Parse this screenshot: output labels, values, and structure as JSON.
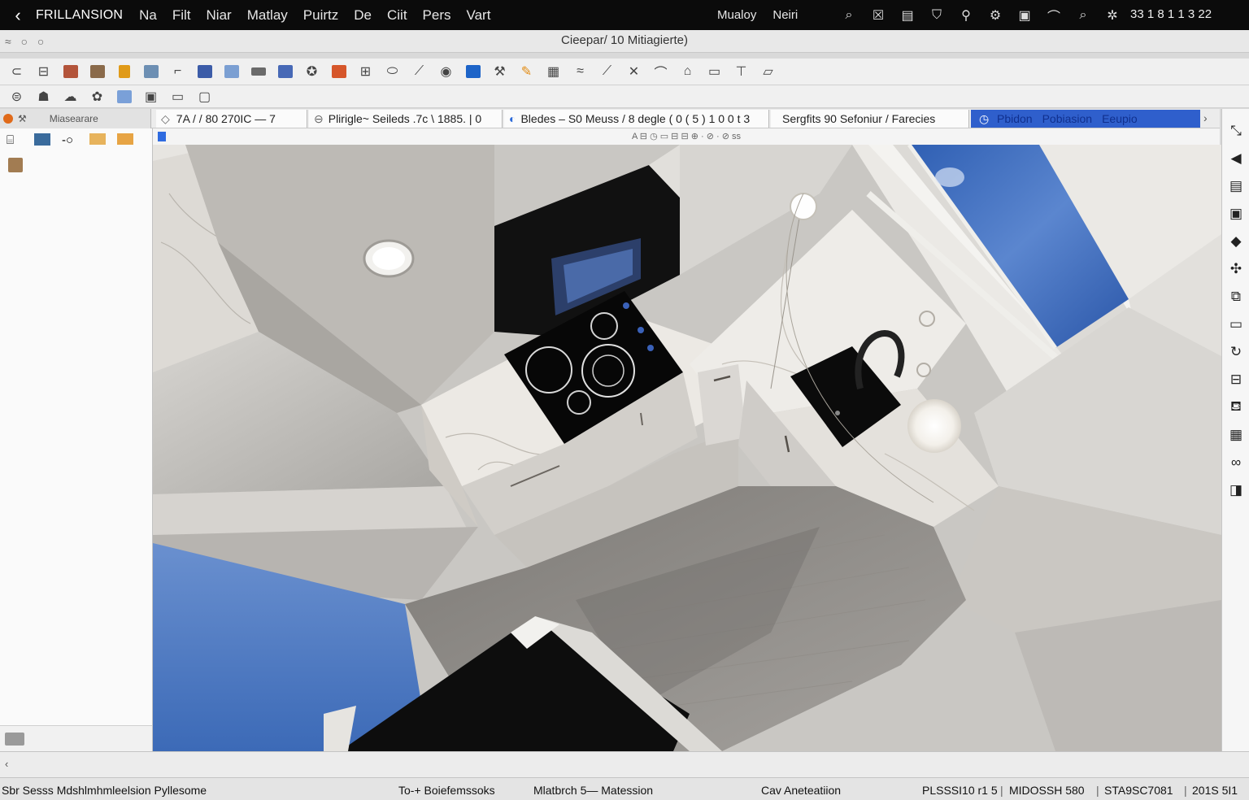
{
  "menubar": {
    "app_name": "FRILLANSION",
    "items": [
      "Na",
      "Filt",
      "Niar",
      "Matlay",
      "Puirtz",
      "De",
      "Ciit",
      "Pers",
      "Vart"
    ],
    "right_items": [
      "Mualoy",
      "Neiri"
    ],
    "clock": "33 1 8 1 1 3 22"
  },
  "titlebar": {
    "title": "Cieepar/ 10 Mitiagierte)"
  },
  "left_panel": {
    "header": "Miasearare"
  },
  "tabs": [
    {
      "label": "7A / / 80 270IC — 7"
    },
    {
      "label": "Plirigle~ Seileds .7c \\ 1885. | 0"
    },
    {
      "label": "Bledes – S0 Meuss / 8 degle ( 0 ( 5 ) 1 0 0 t 3"
    },
    {
      "label": "Sergfits 90 Sefoniur / Farecies"
    },
    {
      "label": "Pbidon"
    },
    {
      "label": "Pobiasion"
    },
    {
      "label": "Eeupio"
    }
  ],
  "subruler": {
    "label": "A ⊟ ◷ ▭ ⊟ ⊟ ⊕ · ⊘ · ⊘ ss"
  },
  "statusbar": {
    "left": "Sbr Sesss Mdshlmhmleelsion Pyllesome",
    "mid1": "To-+ Boiefemssoks",
    "mid2": "Mlatbrch 5— Matession",
    "mid3": "Cav Aneteatiion",
    "right1": "PLSSSI10 r1 5",
    "right2": "MIDOSSH 580",
    "right3": "STA9SC7081",
    "right4": "201S 5I1"
  },
  "colors": {
    "menubar_bg": "#0b0b0b",
    "accent_blue": "#2f5fcc",
    "sky": "#4f7dc8",
    "black_panel": "#0d0d0d"
  }
}
